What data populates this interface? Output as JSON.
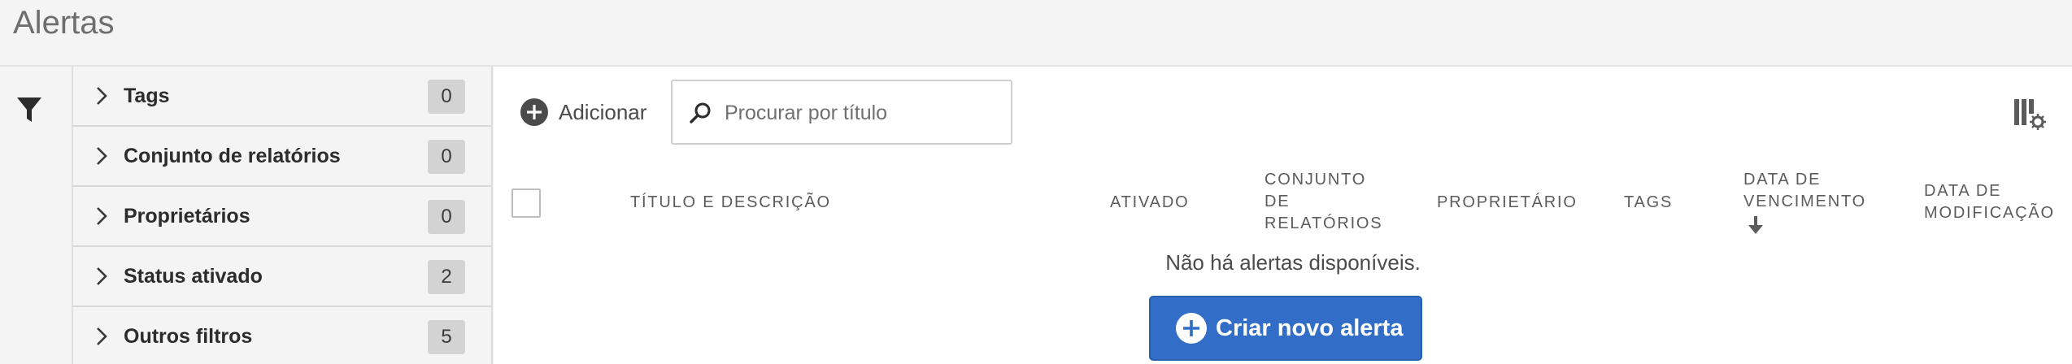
{
  "page": {
    "title": "Alertas"
  },
  "filters": [
    {
      "label": "Tags",
      "count": "0"
    },
    {
      "label": "Conjunto de relatórios",
      "count": "0"
    },
    {
      "label": "Proprietários",
      "count": "0"
    },
    {
      "label": "Status ativado",
      "count": "2"
    },
    {
      "label": "Outros filtros",
      "count": "5"
    }
  ],
  "toolbar": {
    "add_label": "Adicionar",
    "search_placeholder": "Procurar por título"
  },
  "table": {
    "columns": {
      "title": "TÍTULO E DESCRIÇÃO",
      "enabled": "ATIVADO",
      "report_suite_1": "CONJUNTO",
      "report_suite_2": "DE",
      "report_suite_3": "RELATÓRIOS",
      "owner": "PROPRIETÁRIO",
      "tags": "TAGS",
      "due_1": "DATA DE",
      "due_2": "VENCIMENTO",
      "modified_1": "DATA DE",
      "modified_2": "MODIFICAÇÃO"
    },
    "sorted_by": "DATA DE VENCIMENTO",
    "sort_direction": "descending",
    "empty_message": "Não há alertas disponíveis."
  },
  "create_button": {
    "label": "Criar novo alerta"
  },
  "colors": {
    "primary": "#326ec8",
    "background": "#f4f4f4",
    "count_badge": "#d3d3d3"
  },
  "icons": {
    "filter": "funnel",
    "add": "plus-circle",
    "search": "magnifier",
    "column_settings": "columns-gear",
    "sort": "arrow-down",
    "chevron": "chevron-right"
  }
}
